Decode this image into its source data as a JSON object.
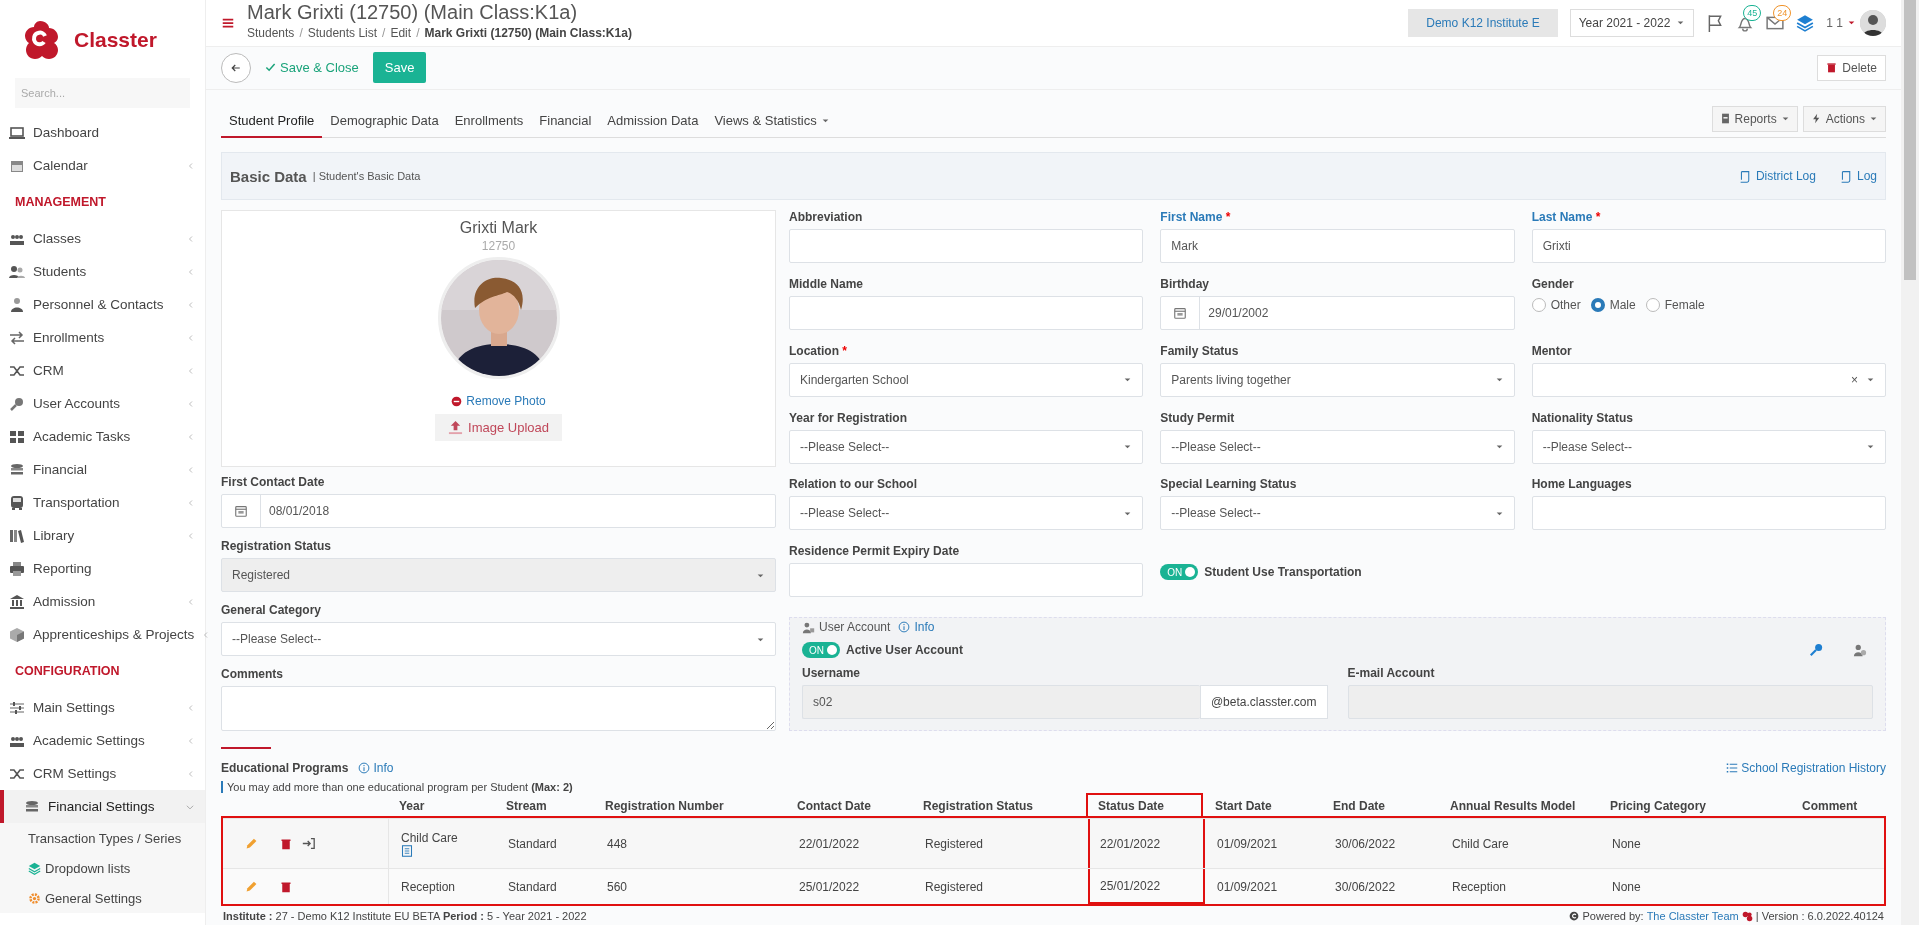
{
  "sidebar": {
    "logo_text": "Classter",
    "search_placeholder": "Search...",
    "items": [
      {
        "kind": "link",
        "label": "Dashboard",
        "submenu": false,
        "selected": false
      },
      {
        "kind": "link",
        "label": "Calendar",
        "submenu": true,
        "selected": false
      },
      {
        "kind": "section",
        "label": "MANAGEMENT"
      },
      {
        "kind": "link",
        "label": "Classes",
        "submenu": true,
        "selected": false
      },
      {
        "kind": "link",
        "label": "Students",
        "submenu": true,
        "selected": false
      },
      {
        "kind": "link",
        "label": "Personnel & Contacts",
        "submenu": true,
        "selected": false
      },
      {
        "kind": "link",
        "label": "Enrollments",
        "submenu": true,
        "selected": false
      },
      {
        "kind": "link",
        "label": "CRM",
        "submenu": true,
        "selected": false
      },
      {
        "kind": "link",
        "label": "User Accounts",
        "submenu": true,
        "selected": false
      },
      {
        "kind": "link",
        "label": "Academic Tasks",
        "submenu": true,
        "selected": false
      },
      {
        "kind": "link",
        "label": "Financial",
        "submenu": true,
        "selected": false
      },
      {
        "kind": "link",
        "label": "Transportation",
        "submenu": true,
        "selected": false
      },
      {
        "kind": "link",
        "label": "Library",
        "submenu": true,
        "selected": false
      },
      {
        "kind": "link",
        "label": "Reporting",
        "submenu": false,
        "selected": false
      },
      {
        "kind": "link",
        "label": "Admission",
        "submenu": true,
        "selected": false
      },
      {
        "kind": "link",
        "label": "Apprenticeships & Projects",
        "submenu": true,
        "selected": false
      },
      {
        "kind": "section",
        "label": "CONFIGURATION"
      },
      {
        "kind": "link",
        "label": "Main Settings",
        "submenu": true,
        "selected": false
      },
      {
        "kind": "link",
        "label": "Academic Settings",
        "submenu": true,
        "selected": false
      },
      {
        "kind": "link",
        "label": "CRM Settings",
        "submenu": true,
        "selected": false
      },
      {
        "kind": "link",
        "label": "Financial Settings",
        "submenu": true,
        "selected": true,
        "expanded": true,
        "children": [
          {
            "label": "Transaction Types / Series"
          },
          {
            "label": "Dropdown lists"
          },
          {
            "label": "General Settings"
          }
        ]
      }
    ]
  },
  "header": {
    "title": "Mark Grixti (12750) (Main Class:K1a)",
    "separator": "/",
    "breadcrumbs": [
      "Students",
      "Students List",
      "Edit",
      "Mark Grixti (12750) (Main Class:K1a)"
    ],
    "institute": "Demo K12 Institute E",
    "year": "Year 2021 - 2022",
    "notifications": "45",
    "messages": "24",
    "user": "1 1"
  },
  "toolbar": {
    "save_close": "Save & Close",
    "save": "Save",
    "delete": "Delete"
  },
  "tabs": [
    {
      "label": "Student Profile",
      "selected": true,
      "dropdown": false
    },
    {
      "label": "Demographic Data",
      "selected": false,
      "dropdown": false
    },
    {
      "label": "Enrollments",
      "selected": false,
      "dropdown": false
    },
    {
      "label": "Financial",
      "selected": false,
      "dropdown": false
    },
    {
      "label": "Admission Data",
      "selected": false,
      "dropdown": false
    },
    {
      "label": "Views & Statistics",
      "selected": false,
      "dropdown": true
    }
  ],
  "tab_actions": [
    "Reports",
    "Actions"
  ],
  "section": {
    "title": "Basic Data",
    "subtitle": "| Student's Basic Data",
    "links": [
      "District Log",
      "Log"
    ]
  },
  "profile": {
    "name": "Grixti Mark",
    "id": "12750",
    "remove_photo": "Remove Photo",
    "upload": "Image Upload"
  },
  "left_fields": [
    {
      "kind": "date",
      "label": "First Contact Date",
      "value": "08/01/2018",
      "disabled": false
    },
    {
      "kind": "select",
      "label": "Registration Status",
      "value": "Registered",
      "disabled": true
    },
    {
      "kind": "select",
      "label": "General Category",
      "value": "--Please Select--",
      "disabled": false
    },
    {
      "kind": "textarea",
      "label": "Comments",
      "disabled": false
    }
  ],
  "fields": [
    {
      "kind": "text",
      "label": "Abbreviation",
      "primary": false
    },
    {
      "kind": "text",
      "label": "First Name",
      "required": "*",
      "primary": true,
      "value": "Mark"
    },
    {
      "kind": "text",
      "label": "Last Name",
      "required": "*",
      "primary": true,
      "value": "Grixti"
    },
    {
      "kind": "text",
      "label": "Middle Name",
      "primary": false
    },
    {
      "kind": "date",
      "label": "Birthday",
      "primary": false,
      "value": "29/01/2002"
    },
    {
      "kind": "radio",
      "label": "Gender",
      "primary": false,
      "options": [
        {
          "label": "Other",
          "selected": false
        },
        {
          "label": "Male",
          "selected": true
        },
        {
          "label": "Female",
          "selected": false
        }
      ]
    },
    {
      "kind": "select",
      "label": "Location",
      "required": "*",
      "primary": false,
      "value": "Kindergarten School"
    },
    {
      "kind": "select",
      "label": "Family Status",
      "primary": false,
      "value": "Parents living together"
    },
    {
      "kind": "select",
      "label": "Mentor",
      "primary": false,
      "clear": "×"
    },
    {
      "kind": "select",
      "label": "Year for Registration",
      "primary": false,
      "value": "--Please Select--"
    },
    {
      "kind": "select",
      "label": "Study Permit",
      "primary": false,
      "value": "--Please Select--"
    },
    {
      "kind": "select",
      "label": "Nationality Status",
      "primary": false,
      "value": "--Please Select--"
    },
    {
      "kind": "select",
      "label": "Relation to our School",
      "primary": false,
      "value": "--Please Select--"
    },
    {
      "kind": "select",
      "label": "Special Learning Status",
      "primary": false,
      "value": "--Please Select--"
    },
    {
      "kind": "text",
      "label": "Home Languages",
      "primary": false
    },
    {
      "kind": "text",
      "label": "Residence Permit Expiry Date",
      "primary": false
    },
    {
      "kind": "toggle",
      "label": "Student Use Transportation",
      "on": true,
      "text": "ON"
    }
  ],
  "user_account": {
    "legend": "User Account",
    "info": "Info",
    "toggle": {
      "label": "Active User Account",
      "on": true,
      "text": "ON"
    },
    "username_label": "Username",
    "username": "s02",
    "domain": "@beta.classter.com",
    "email_label": "E-mail Account"
  },
  "programs": {
    "title": "Educational Programs",
    "info": "Info",
    "note": "You may add more than one educational program per Student **(Max: 2)**",
    "history": "School Registration History",
    "highlighted": true,
    "columns": [
      {
        "label": "Year",
        "highlighted": false
      },
      {
        "label": "Stream",
        "highlighted": false
      },
      {
        "label": "Registration Number",
        "highlighted": false
      },
      {
        "label": "Contact Date",
        "highlighted": false
      },
      {
        "label": "Registration Status",
        "highlighted": false
      },
      {
        "label": "Status Date",
        "highlighted": true
      },
      {
        "label": "Start Date",
        "highlighted": false
      },
      {
        "label": "End Date",
        "highlighted": false
      },
      {
        "label": "Annual Results Model",
        "highlighted": false
      },
      {
        "label": "Pricing Category",
        "highlighted": false
      },
      {
        "label": "Comment",
        "highlighted": false
      }
    ],
    "rows": [
      {
        "enter_icon": true,
        "note_icon": true,
        "cells": [
          "Child Care",
          "Standard",
          "448",
          "22/01/2022",
          "Registered",
          "22/01/2022",
          "01/09/2021",
          "30/06/2022",
          "Child Care",
          "None"
        ]
      },
      {
        "enter_icon": false,
        "note_icon": false,
        "cells": [
          "Reception",
          "Standard",
          "560",
          "25/01/2022",
          "Registered",
          "25/01/2022",
          "01/09/2021",
          "30/06/2022",
          "Reception",
          "None"
        ]
      }
    ]
  },
  "footer": {
    "info": "**Institute :** 27 - Demo K12 Institute EU BETA **Period :** 5 - Year 2021 - 2022",
    "powered": "Powered by:",
    "team": "The Classter Team",
    "version": "| Version : 6.0.2022.40124"
  }
}
